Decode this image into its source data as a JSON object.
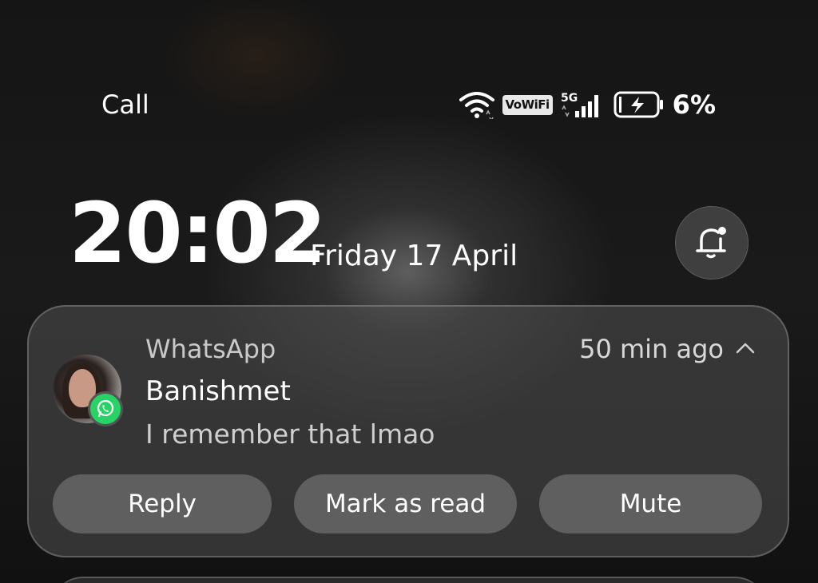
{
  "status_bar": {
    "left_label": "Call",
    "vowifi_label": "VoWiFi",
    "network_label": "5G",
    "battery_percent": "6%",
    "icons": [
      "wifi-icon",
      "signal-icon",
      "battery-charging-icon"
    ]
  },
  "lock": {
    "time": "20:02",
    "date": "Friday 17 April",
    "bell_icon": "notification-bell-icon"
  },
  "notification": {
    "app_name": "WhatsApp",
    "time_ago": "50 min ago",
    "sender": "Banishmet",
    "message": "I remember that lmao",
    "actions": {
      "reply": "Reply",
      "mark_read": "Mark as read",
      "mute": "Mute"
    },
    "badge_color": "#28d366"
  }
}
